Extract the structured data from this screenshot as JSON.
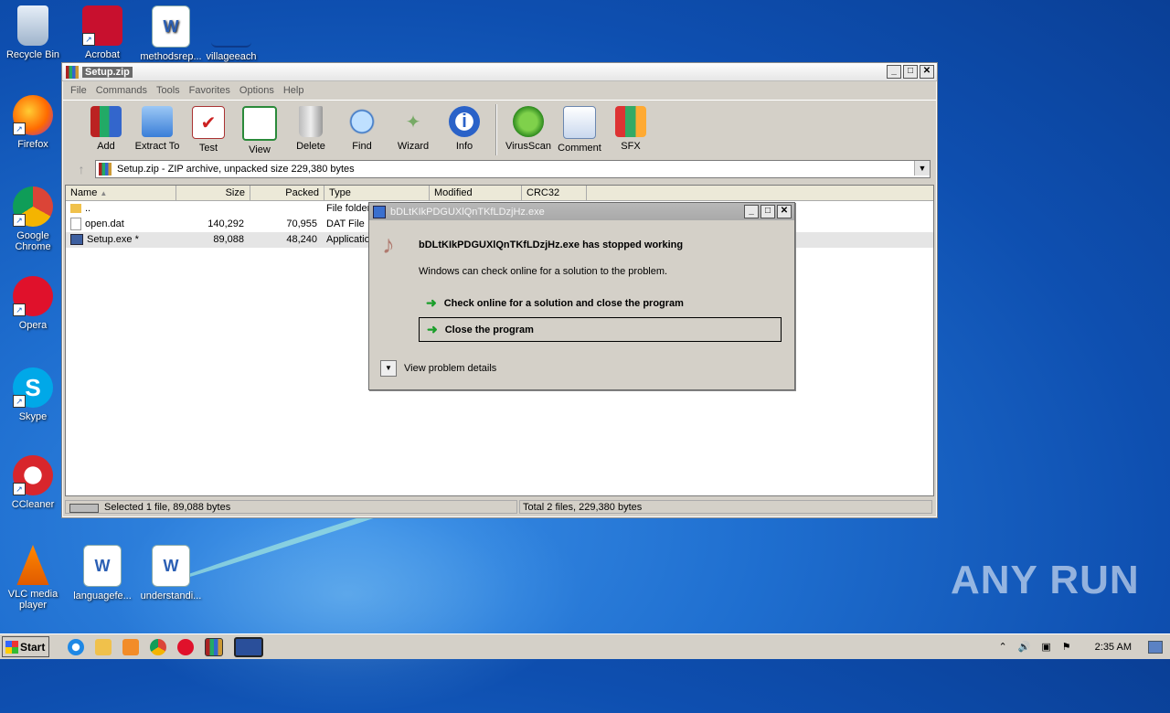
{
  "desktop": {
    "icons": [
      {
        "label": "Recycle Bin"
      },
      {
        "label": "Acrobat"
      },
      {
        "label": "methodsrep..."
      },
      {
        "label": "villageeach"
      },
      {
        "label": "Firefox"
      },
      {
        "label": "Google Chrome"
      },
      {
        "label": "Opera"
      },
      {
        "label": "Skype"
      },
      {
        "label": "CCleaner"
      },
      {
        "label": "VLC media player"
      },
      {
        "label": "languagefe..."
      },
      {
        "label": "understandi..."
      }
    ],
    "watermark": "ANY RUN"
  },
  "winrar": {
    "title": "Setup.zip",
    "menu": [
      "File",
      "Commands",
      "Tools",
      "Favorites",
      "Options",
      "Help"
    ],
    "toolbar": [
      "Add",
      "Extract To",
      "Test",
      "View",
      "Delete",
      "Find",
      "Wizard",
      "Info",
      "VirusScan",
      "Comment",
      "SFX"
    ],
    "address": "Setup.zip - ZIP archive, unpacked size 229,380 bytes",
    "columns": [
      "Name",
      "Size",
      "Packed",
      "Type",
      "Modified",
      "CRC32"
    ],
    "rows": [
      {
        "name": "..",
        "size": "",
        "packed": "",
        "type": "File folder"
      },
      {
        "name": "open.dat",
        "size": "140,292",
        "packed": "70,955",
        "type": "DAT File"
      },
      {
        "name": "Setup.exe *",
        "size": "89,088",
        "packed": "48,240",
        "type": "Application"
      }
    ],
    "status_left": "Selected 1 file, 89,088 bytes",
    "status_right": "Total 2 files, 229,380 bytes"
  },
  "dialog": {
    "title": "bDLtKIkPDGUXlQnTKfLDzjHz.exe",
    "headline": "bDLtKIkPDGUXlQnTKfLDzjHz.exe has stopped working",
    "message": "Windows can check online for a solution to the problem.",
    "option_check": "Check online for a solution and close the program",
    "option_close": "Close the program",
    "details": "View problem details"
  },
  "taskbar": {
    "start": "Start",
    "clock": "2:35 AM"
  },
  "colors": {
    "accent_green": "#1a9e2a",
    "desktop_blue": "#1f6fd0"
  }
}
